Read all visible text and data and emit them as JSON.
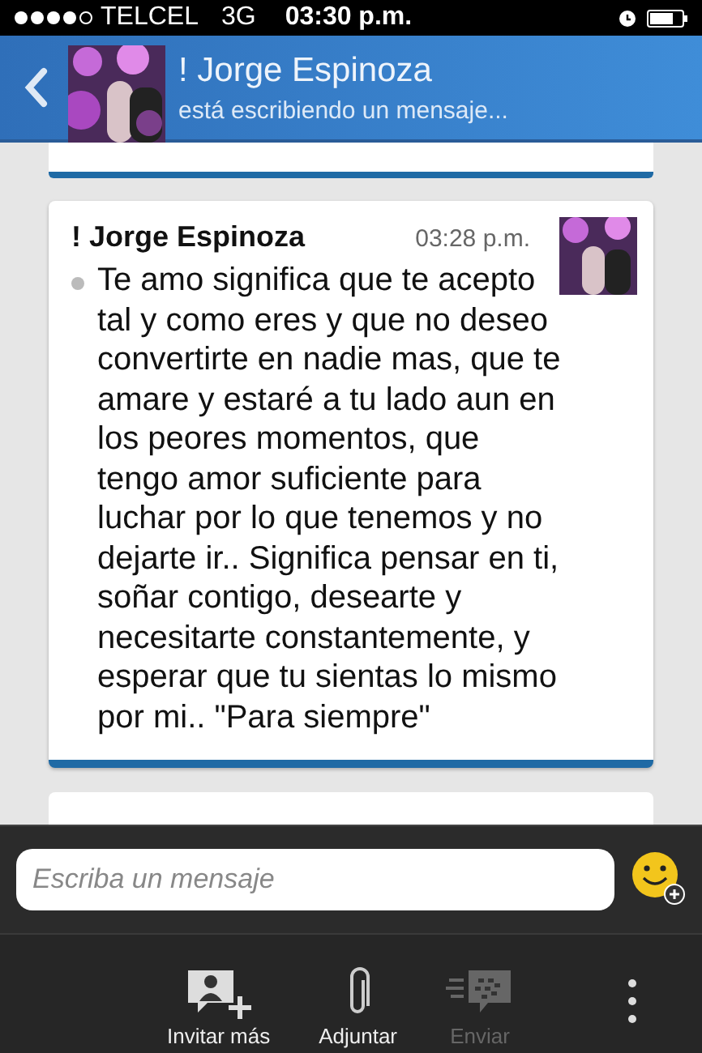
{
  "status_bar": {
    "carrier": "TELCEL",
    "network": "3G",
    "time": "03:30 p.m."
  },
  "header": {
    "name": "! Jorge Espinoza",
    "status": "está escribiendo un mensaje..."
  },
  "messages": [
    {
      "sender": "! Jorge Espinoza",
      "time": "03:28 p.m.",
      "text": "Te amo significa que te acepto tal y como eres y que no deseo convertirte en nadie mas, que te amare y estaré a tu lado aun en los peores momentos, que tengo amor suficiente para luchar por lo que tenemos y no dejarte ir.. Significa pensar en ti, soñar contigo, desearte y necesitarte constantemente, y esperar que tu sientas lo mismo por mi.. \"Para siempre\""
    }
  ],
  "composer": {
    "placeholder": "Escriba un mensaje"
  },
  "toolbar": [
    {
      "kind": "invite",
      "label": "Invitar más",
      "disabled": false
    },
    {
      "kind": "attach",
      "label": "Adjuntar",
      "disabled": false
    },
    {
      "kind": "send",
      "label": "Enviar",
      "disabled": true
    },
    {
      "kind": "more"
    }
  ]
}
